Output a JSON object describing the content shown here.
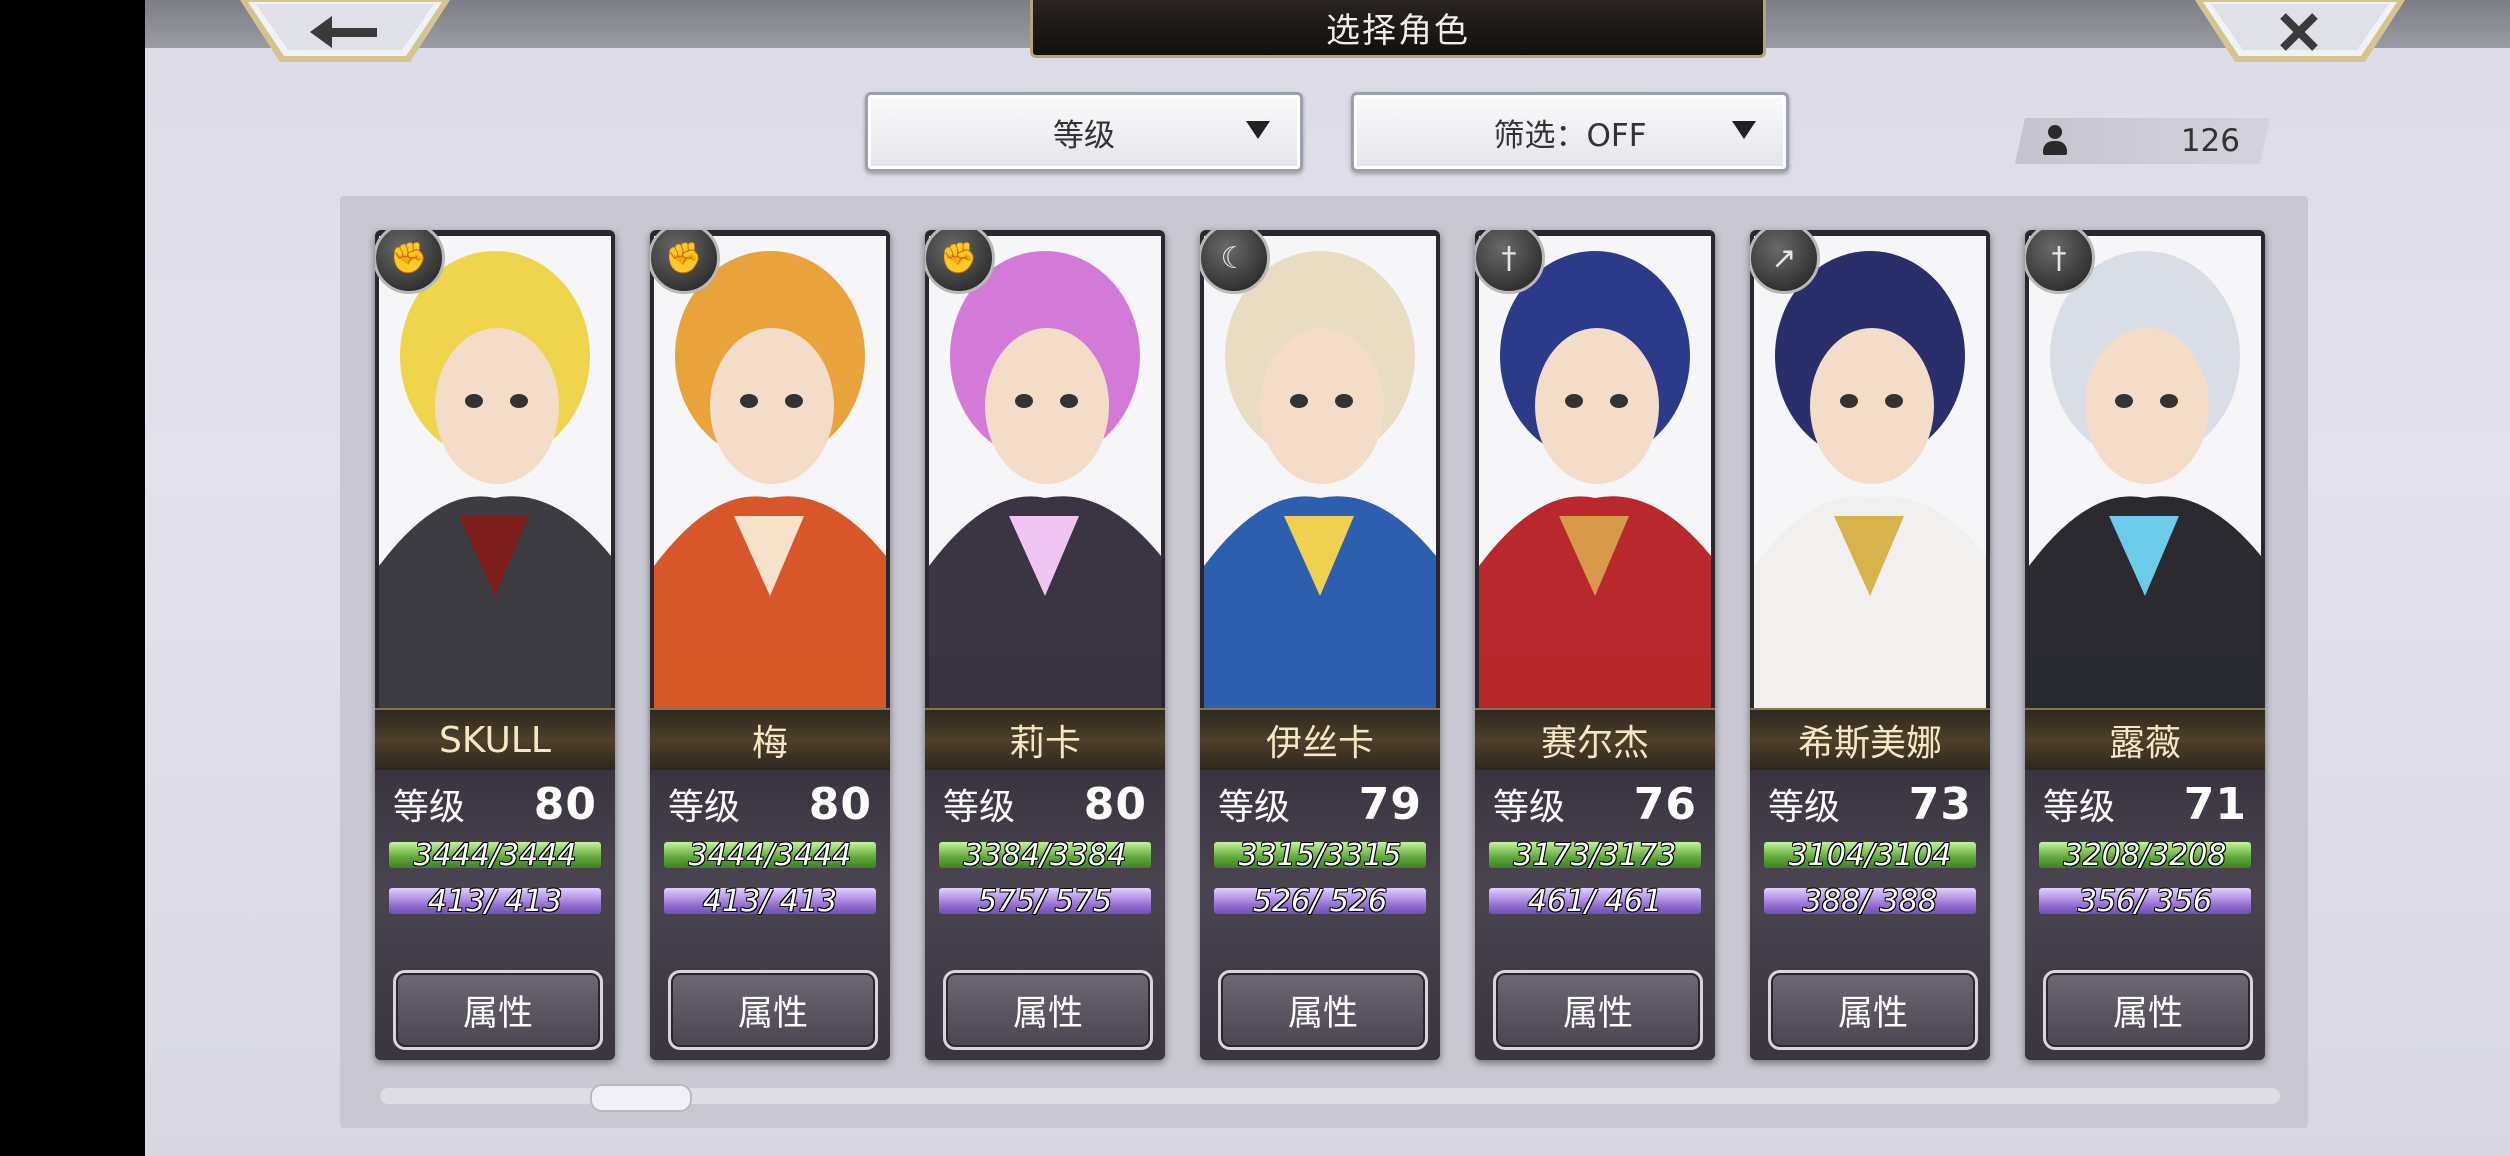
{
  "header": {
    "title": "选择角色",
    "back_icon": "arrow-left-icon",
    "close_icon": "close-x-icon"
  },
  "controls": {
    "sort_label": "等级",
    "filter_label": "筛选：OFF",
    "character_count": "126"
  },
  "characters": [
    {
      "name": "SKULL",
      "level_label": "等级",
      "level": "80",
      "hp": "3444/3444",
      "mp": "413/ 413",
      "attr_label": "属性",
      "weapon_icon": "gauntlet-icon",
      "portrait_colors": [
        "#efd44e",
        "#3c3c42",
        "#7d1f1a"
      ]
    },
    {
      "name": "梅",
      "level_label": "等级",
      "level": "80",
      "hp": "3444/3444",
      "mp": "413/ 413",
      "attr_label": "属性",
      "weapon_icon": "gauntlet-icon",
      "portrait_colors": [
        "#e8a33c",
        "#d8572a",
        "#f6e1c9"
      ]
    },
    {
      "name": "莉卡",
      "level_label": "等级",
      "level": "80",
      "hp": "3384/3384",
      "mp": "575/ 575",
      "attr_label": "属性",
      "weapon_icon": "gauntlet-icon",
      "portrait_colors": [
        "#d37ad8",
        "#3b3442",
        "#f1c5f2"
      ]
    },
    {
      "name": "伊丝卡",
      "level_label": "等级",
      "level": "79",
      "hp": "3315/3315",
      "mp": "526/ 526",
      "attr_label": "属性",
      "weapon_icon": "scythe-icon",
      "portrait_colors": [
        "#e8dcc2",
        "#2d5fae",
        "#f0d050"
      ]
    },
    {
      "name": "赛尔杰",
      "level_label": "等级",
      "level": "76",
      "hp": "3173/3173",
      "mp": "461/ 461",
      "attr_label": "属性",
      "weapon_icon": "sword-icon",
      "portrait_colors": [
        "#2d3a8a",
        "#b8282c",
        "#d89a4a"
      ]
    },
    {
      "name": "希斯美娜",
      "level_label": "等级",
      "level": "73",
      "hp": "3104/3104",
      "mp": "388/ 388",
      "attr_label": "属性",
      "weapon_icon": "spear-icon",
      "portrait_colors": [
        "#2a2e6a",
        "#f2f0ee",
        "#d8b24a"
      ]
    },
    {
      "name": "露薇",
      "level_label": "等级",
      "level": "71",
      "hp": "3208/3208",
      "mp": "356/ 356",
      "attr_label": "属性",
      "weapon_icon": "sword-icon",
      "portrait_colors": [
        "#d9dde6",
        "#2a2a30",
        "#6ccbe8"
      ]
    }
  ],
  "scrollbar": {
    "position_fraction": 0.11
  }
}
